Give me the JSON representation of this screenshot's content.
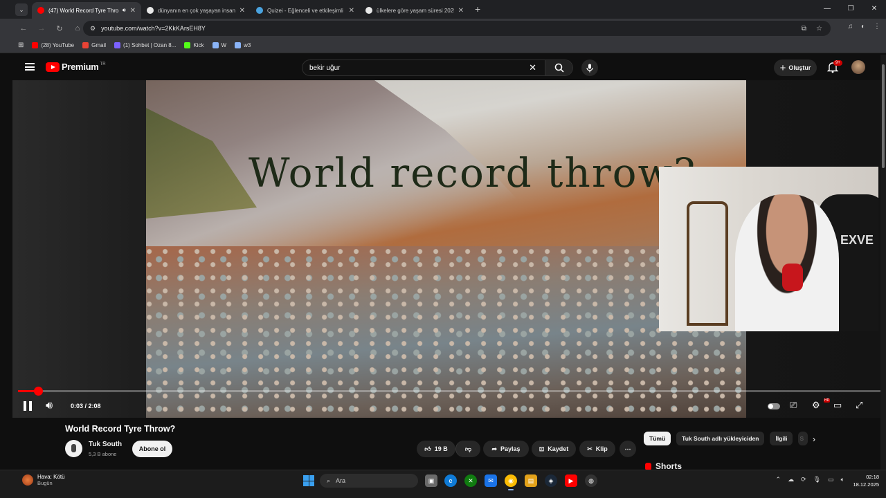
{
  "browser": {
    "tabs": [
      {
        "title": "(47) World Record Tyre Thro",
        "active": true,
        "favicon_color": "#ff0000",
        "audio": true
      },
      {
        "title": "dünyanın en çok yaşayan insan",
        "active": false,
        "favicon_color": "#e8e8e8"
      },
      {
        "title": "Quizei - Eğlenceli ve etkileşimli",
        "active": false,
        "favicon_color": "#4aa3df"
      },
      {
        "title": "ülkelere göre yaşam süresi 2025",
        "active": false,
        "favicon_color": "#e8e8e8"
      }
    ],
    "url": "youtube.com/watch?v=2KkKArsEH8Y",
    "bookmarks": [
      {
        "label": "(28) YouTube",
        "color": "#ff0000"
      },
      {
        "label": "Gmail",
        "color": "#ea4335"
      },
      {
        "label": "(1) Sohbet | Ozan 8...",
        "color": "#7b61ff"
      },
      {
        "label": "Kick",
        "color": "#53fc18"
      },
      {
        "label": "W",
        "color": "#8ab4f8"
      },
      {
        "label": "w3",
        "color": "#8ab4f8"
      }
    ]
  },
  "youtube": {
    "logo_text": "Premium",
    "logo_tm": "TR",
    "search_query": "bekir uğur",
    "create_label": "Oluştur",
    "notifications_badge": "9+",
    "video_overlay_text": "World record throw?",
    "webcam_brand": "EXVE",
    "player": {
      "time": "0:03 / 2:08",
      "progress_fraction": 0.023,
      "hd_badge": "HD"
    },
    "video_title": "World Record Tyre Throw?",
    "channel_name": "Tuk South",
    "channel_subs": "5,3 B abone",
    "subscribe_label": "Abone ol",
    "actions": {
      "likes": "19 B",
      "share": "Paylaş",
      "save": "Kaydet",
      "clip": "Klip"
    },
    "chips": [
      "Tümü",
      "Tuk South adlı yükleyiciden",
      "İlgili",
      "S"
    ],
    "shorts_label": "Shorts"
  },
  "taskbar": {
    "weather_title": "Hava: Kötü",
    "weather_sub": "Bugün",
    "search_placeholder": "Ara",
    "time": "02:18",
    "date": "18.12.2025"
  }
}
